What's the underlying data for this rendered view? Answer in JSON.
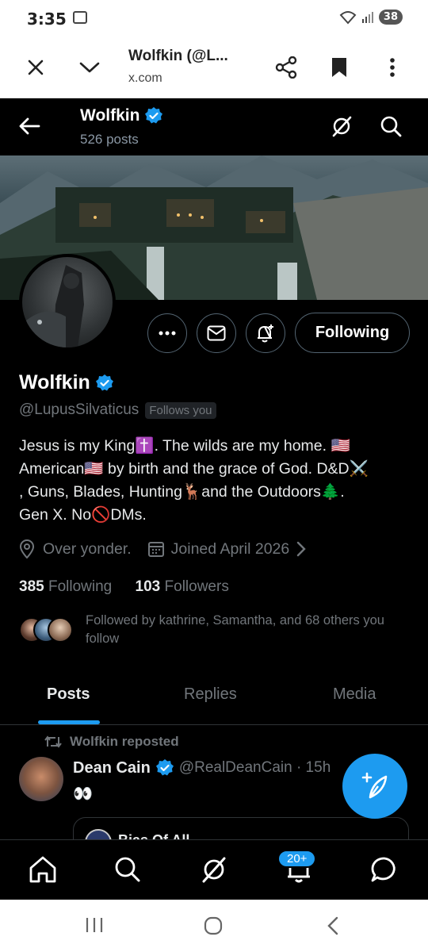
{
  "status_bar": {
    "time": "3:35",
    "battery": "38"
  },
  "browser": {
    "title": "Wolfkin (@L...",
    "url": "x.com",
    "icons": [
      "close-icon",
      "chevron-down-icon",
      "share-icon",
      "bookmark-icon",
      "more-vertical-icon"
    ]
  },
  "header": {
    "name": "Wolfkin",
    "posts_count": "526 posts"
  },
  "profile": {
    "name": "Wolfkin",
    "handle": "@LupusSilvaticus",
    "follows_you": "Follows you",
    "follow_button": "Following",
    "bio_lines": [
      "Jesus is my King✝️. The wilds are my home. 🇺🇸",
      "American🇺🇸 by birth and the grace of God. D&D⚔️",
      ", Guns, Blades, Hunting🦌and the Outdoors🌲.",
      "Gen X. No🚫DMs."
    ],
    "location": "Over yonder.",
    "joined": "Joined April 2026",
    "following_count": "385",
    "following_label": "Following",
    "followers_count": "103",
    "followers_label": "Followers",
    "followed_by": "Followed by kathrine, Samantha, and 68 others you follow"
  },
  "tabs": [
    "Posts",
    "Replies",
    "Media"
  ],
  "timeline": {
    "repost_label": "Wolfkin reposted",
    "tweet": {
      "name": "Dean Cain",
      "handle": "@RealDeanCain · 15h",
      "text": "👀"
    },
    "quote": {
      "name": "Bias Of All..."
    }
  },
  "bottom_nav": {
    "notif_badge": "20+"
  },
  "colors": {
    "accent": "#1d9bf0",
    "background": "#000000",
    "muted": "#71767b"
  }
}
